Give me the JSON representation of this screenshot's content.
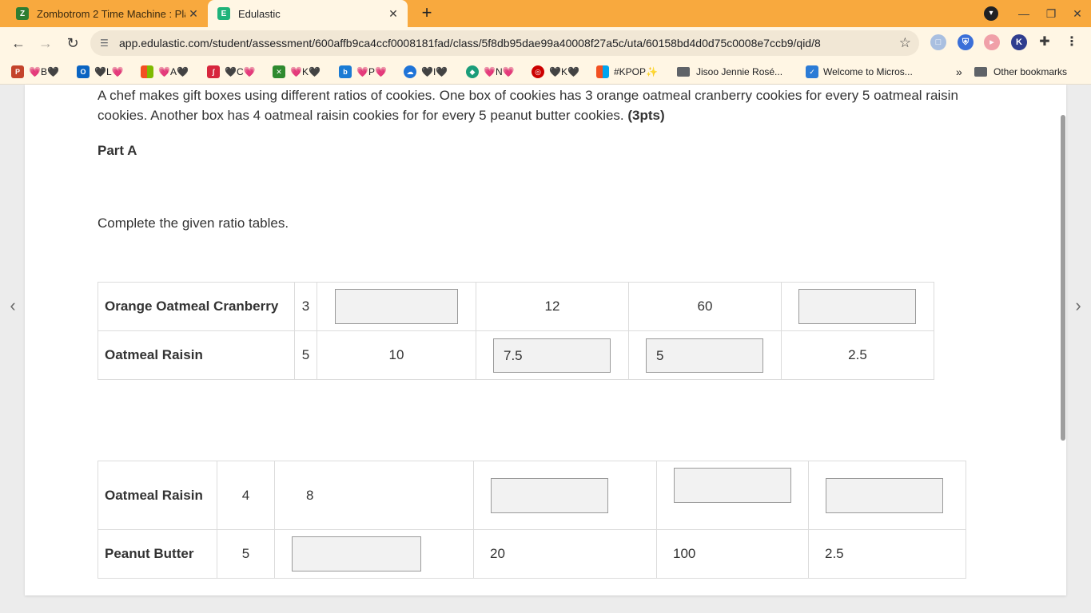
{
  "browser": {
    "tabs": [
      {
        "title": "Zombotrom 2 Time Machine : Pla",
        "active": false,
        "favicon": "zombotron-favicon"
      },
      {
        "title": "Edulastic",
        "active": true,
        "favicon": "edulastic-favicon"
      }
    ],
    "url": "app.edulastic.com/student/assessment/600affb9ca4ccf0008181fad/class/5f8db95dae99a40008f27a5c/uta/60158bd4d0d75c0008e7ccb9/qid/8",
    "bookmarks": [
      {
        "label": "💗B🖤",
        "icon": "powerpoint-icon"
      },
      {
        "label": "🖤L💗",
        "icon": "outlook-icon"
      },
      {
        "label": "💗A🖤",
        "icon": "microsoft-icon"
      },
      {
        "label": "🖤C💗",
        "icon": "red-app-icon"
      },
      {
        "label": "💗K🖤",
        "icon": "xbox-icon"
      },
      {
        "label": "💗P💗",
        "icon": "bing-icon"
      },
      {
        "label": "🖤I🖤",
        "icon": "onedrive-icon"
      },
      {
        "label": "💗N💗",
        "icon": "gem-icon"
      },
      {
        "label": "🖤K🖤",
        "icon": "target-icon"
      },
      {
        "label": "#KPOP✨",
        "icon": "microsoft-icon"
      },
      {
        "label": "Jisoo Jennie Rosé...",
        "icon": "folder-icon"
      },
      {
        "label": "Welcome to Micros...",
        "icon": "todo-icon"
      }
    ],
    "overflow": "»",
    "other_bookmarks": "Other bookmarks"
  },
  "question": {
    "text": "A chef makes gift boxes using different ratios of cookies. One box of cookies has 3 orange oatmeal cranberry cookies for every 5 oatmeal raisin cookies. Another box has 4 oatmeal raisin cookies for for every 5 peanut butter cookies. ",
    "points": "(3pts)",
    "part": "Part A",
    "instruction": "Complete the given ratio tables."
  },
  "table1": {
    "row1": {
      "label": "Orange Oatmeal Cranberry",
      "c1": "3",
      "c2": "",
      "c3": "12",
      "c4": "60",
      "c5": ""
    },
    "row2": {
      "label": "Oatmeal Raisin",
      "c1": "5",
      "c2": "10",
      "c3": "7.5",
      "c4": "5",
      "c5": "2.5"
    }
  },
  "table2": {
    "row1": {
      "label": "Oatmeal Raisin",
      "c1": "4",
      "c2": "8",
      "c3": "",
      "c4": "",
      "c5": ""
    },
    "row2": {
      "label": "Peanut Butter",
      "c1": "5",
      "c2": "",
      "c3": "20",
      "c4": "100",
      "c5": "2.5"
    }
  }
}
